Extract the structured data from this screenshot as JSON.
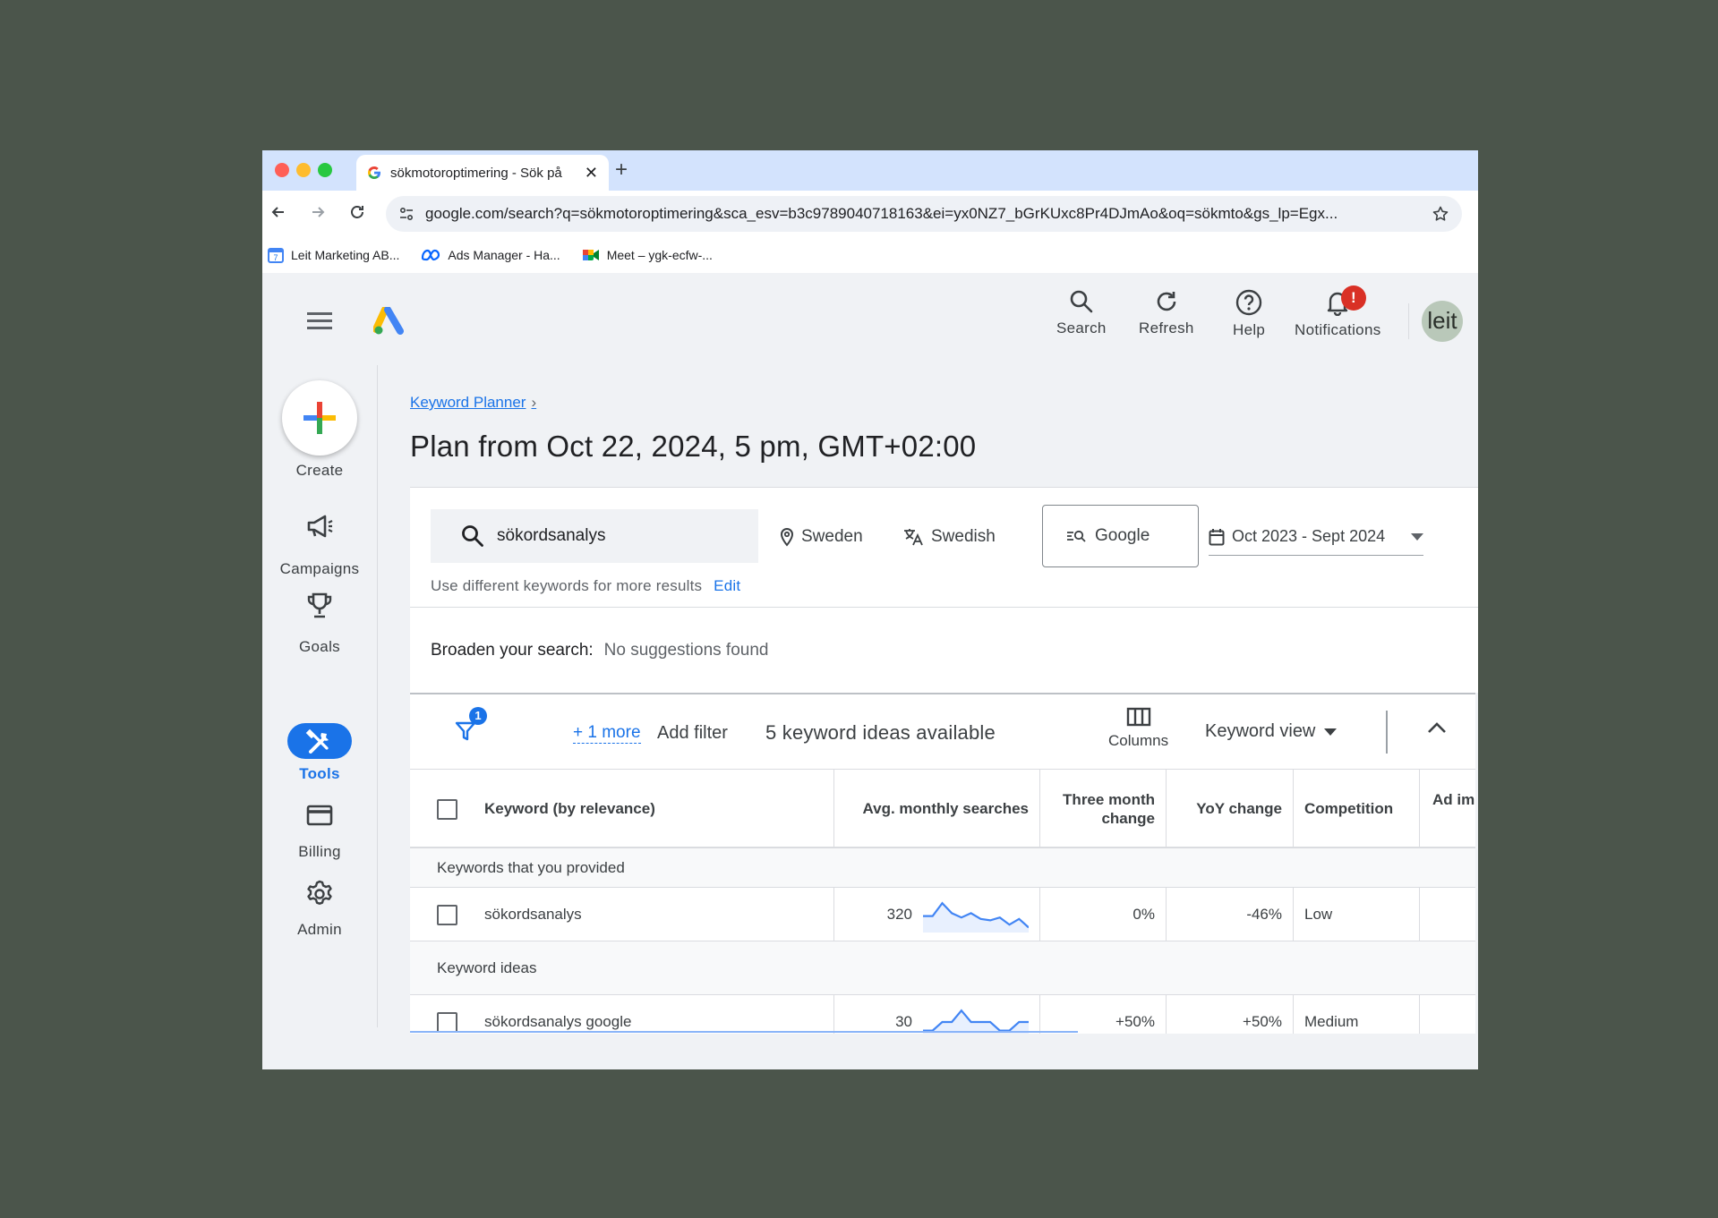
{
  "browser": {
    "tab_title": "sökmotoroptimering - Sök på",
    "url": "google.com/search?q=sökmotoroptimering&sca_esv=b3c9789040718163&ei=yx0NZ7_bGrKUxc8Pr4DJmAo&oq=sökmto&gs_lp=Egx...",
    "bookmarks": [
      {
        "label": "Leit Marketing AB...",
        "icon": "calendar-icon"
      },
      {
        "label": "Ads Manager - Ha...",
        "icon": "meta-icon"
      },
      {
        "label": "Meet – ygk-ecfw-...",
        "icon": "meet-icon"
      }
    ]
  },
  "appbar": {
    "search_label": "Search",
    "refresh_label": "Refresh",
    "help_label": "Help",
    "notifications_label": "Notifications",
    "notifications_badge": "!",
    "avatar_text": "leit"
  },
  "sidenav": {
    "create": "Create",
    "campaigns": "Campaigns",
    "goals": "Goals",
    "tools": "Tools",
    "billing": "Billing",
    "admin": "Admin"
  },
  "page": {
    "breadcrumb": "Keyword Planner",
    "title": "Plan from Oct 22, 2024, 5 pm, GMT+02:00"
  },
  "search": {
    "keyword": "sökordsanalys",
    "location": "Sweden",
    "language": "Swedish",
    "network": "Google",
    "date_range": "Oct 2023 - Sept 2024",
    "hint": "Use different keywords for more results",
    "edit": "Edit"
  },
  "broaden": {
    "label": "Broaden your search:",
    "value": "No suggestions found"
  },
  "table": {
    "filter_count": "1",
    "more_filters": "+ 1 more",
    "add_filter": "Add filter",
    "ideas_count": "5 keyword ideas available",
    "columns_label": "Columns",
    "view_label": "Keyword view",
    "headers": {
      "keyword": "Keyword (by relevance)",
      "avg": "Avg. monthly searches",
      "three_month": "Three month change",
      "yoy": "YoY change",
      "competition": "Competition",
      "ad_impr": "Ad im"
    },
    "group_provided": "Keywords that you provided",
    "group_ideas": "Keyword ideas",
    "rows": [
      {
        "keyword": "sökordsanalys",
        "avg": "320",
        "three_month": "0%",
        "yoy": "-46%",
        "competition": "Low",
        "trend": [
          0.45,
          0.45,
          0.9,
          0.55,
          0.4,
          0.55,
          0.35,
          0.3,
          0.4,
          0.15,
          0.35,
          0.05
        ]
      },
      {
        "keyword": "sökordsanalys google",
        "avg": "30",
        "three_month": "+50%",
        "yoy": "+50%",
        "competition": "Medium",
        "trend": [
          0.2,
          0.2,
          0.5,
          0.5,
          0.9,
          0.5,
          0.5,
          0.5,
          0.2,
          0.2,
          0.5,
          0.5
        ]
      }
    ]
  },
  "colors": {
    "accent": "#1a73e8",
    "badge": "#d93025",
    "background": "#4b554b",
    "trend_line": "#4285f4",
    "trend_fill": "#e8f0fe"
  }
}
